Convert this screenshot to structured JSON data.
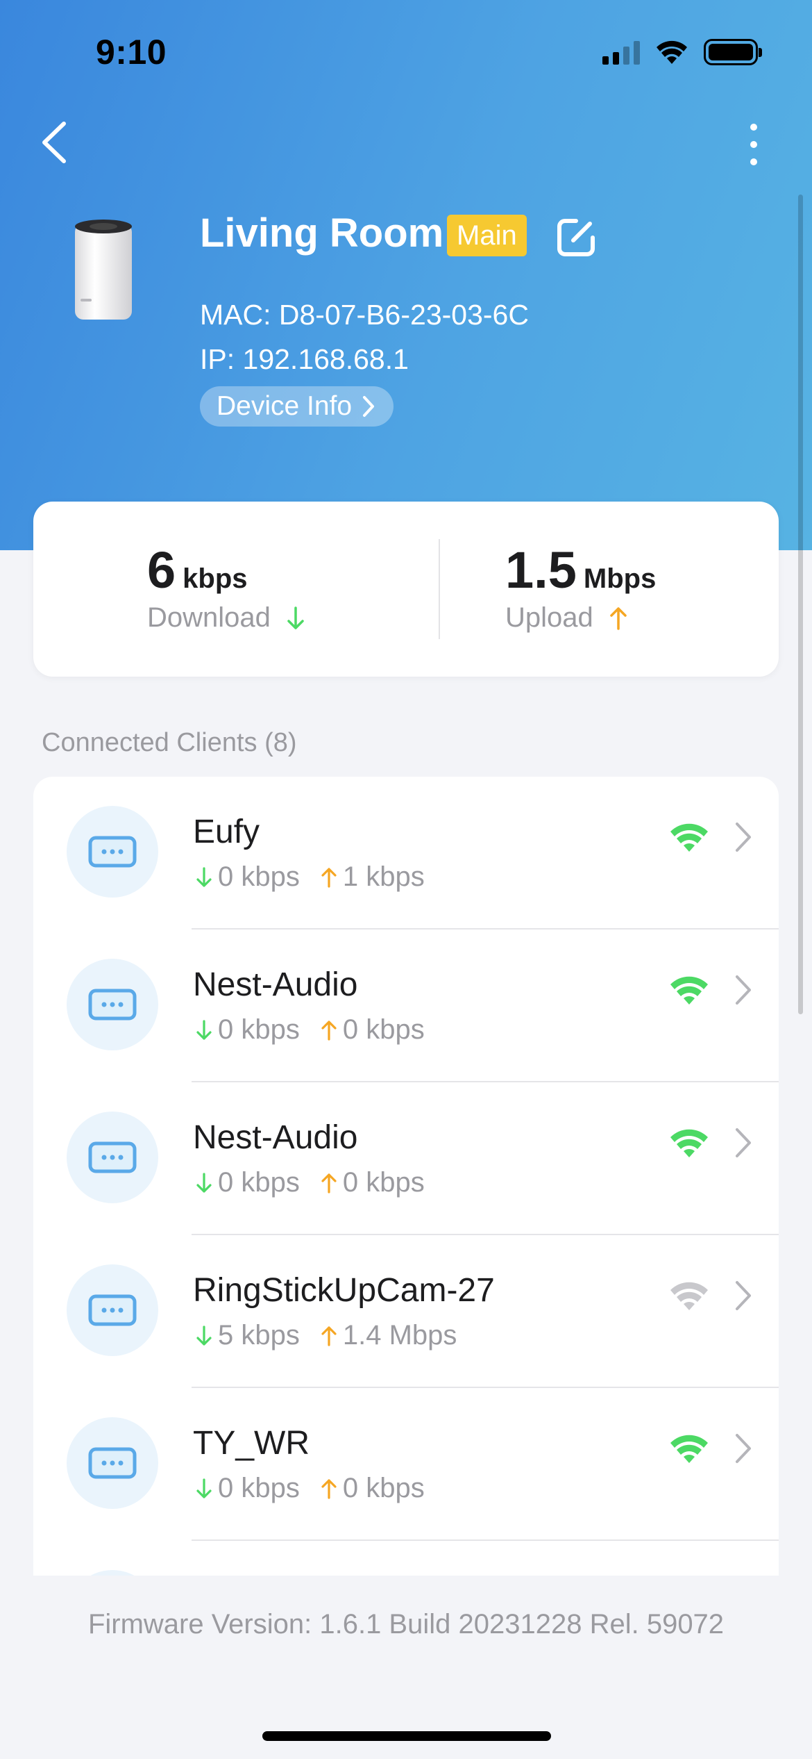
{
  "status_bar": {
    "time": "9:10"
  },
  "device": {
    "name": "Living Room",
    "badge": "Main",
    "mac": "MAC: D8-07-B6-23-03-6C",
    "ip": "IP: 192.168.68.1",
    "info_button": "Device Info"
  },
  "speed": {
    "download_value": "6",
    "download_unit": "kbps",
    "download_label": "Download",
    "upload_value": "1.5",
    "upload_unit": "Mbps",
    "upload_label": "Upload"
  },
  "clients_section": {
    "title": "Connected Clients (8)"
  },
  "clients": [
    {
      "name": "Eufy",
      "down": "0 kbps",
      "up": "1 kbps",
      "signal": "strong"
    },
    {
      "name": "Nest-Audio",
      "down": "0 kbps",
      "up": "0 kbps",
      "signal": "strong"
    },
    {
      "name": "Nest-Audio",
      "down": "0 kbps",
      "up": "0 kbps",
      "signal": "strong"
    },
    {
      "name": "RingStickUpCam-27",
      "down": "5 kbps",
      "up": "1.4 Mbps",
      "signal": "weak"
    },
    {
      "name": "TY_WR",
      "down": "0 kbps",
      "up": "0 kbps",
      "signal": "strong"
    }
  ],
  "footer": {
    "firmware": "Firmware Version: 1.6.1 Build 20231228 Rel. 59072"
  },
  "colors": {
    "accent_blue": "#3a87dd",
    "badge_yellow": "#f6c931",
    "download_green": "#4cd964",
    "upload_orange": "#f5a623",
    "wifi_green": "#4cd964",
    "wifi_weak": "#c8c8cc"
  }
}
